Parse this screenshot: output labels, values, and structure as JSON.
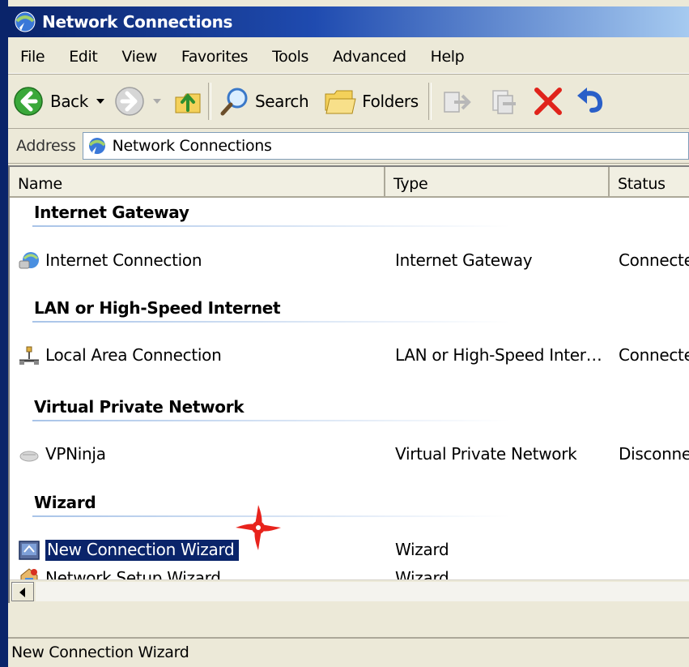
{
  "window": {
    "title": "Network Connections"
  },
  "menu": [
    "File",
    "Edit",
    "View",
    "Favorites",
    "Tools",
    "Advanced",
    "Help"
  ],
  "toolbar": {
    "back_label": "Back",
    "search_label": "Search",
    "folders_label": "Folders"
  },
  "address": {
    "label": "Address",
    "value": "Network Connections"
  },
  "columns": {
    "name": "Name",
    "type": "Type",
    "status": "Status"
  },
  "groups": [
    {
      "title": "Internet Gateway",
      "items": [
        {
          "name": "Internet Connection",
          "type": "Internet Gateway",
          "status": "Connecte",
          "icon": "internet-gateway-icon"
        }
      ]
    },
    {
      "title": "LAN or High-Speed Internet",
      "items": [
        {
          "name": "Local Area Connection",
          "type": "LAN or High-Speed Inter…",
          "status": "Connecte",
          "icon": "lan-connection-icon"
        }
      ]
    },
    {
      "title": "Virtual Private Network",
      "items": [
        {
          "name": "VPNinja",
          "type": "Virtual Private Network",
          "status": "Disconnec",
          "icon": "vpn-connection-icon"
        }
      ]
    },
    {
      "title": "Wizard",
      "items": [
        {
          "name": "New Connection Wizard",
          "type": "Wizard",
          "status": "",
          "icon": "new-connection-wizard-icon",
          "selected": true
        },
        {
          "name": "Network Setup Wizard",
          "type": "Wizard",
          "status": "",
          "icon": "network-setup-wizard-icon"
        }
      ]
    }
  ],
  "statusbar": {
    "text": "New Connection Wizard"
  },
  "colors": {
    "selection": "#0a246a",
    "titlebar": "#0a246a",
    "shuriken": "#e8231c"
  }
}
